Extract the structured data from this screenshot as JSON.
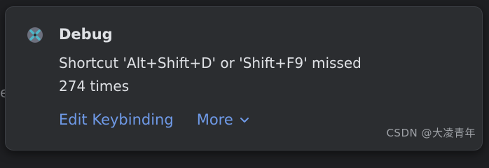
{
  "notification": {
    "title": "Debug",
    "message_line1": "Shortcut 'Alt+Shift+D' or 'Shift+F9' missed",
    "message_line2": "274 times",
    "icon": "debug-icon",
    "actions": {
      "edit_keybinding": "Edit Keybinding",
      "more": "More"
    }
  },
  "background": {
    "fragment": "e"
  },
  "watermark": "CSDN @大凌青年",
  "colors": {
    "popup_bg": "#2b2d30",
    "text": "#dfe1e5",
    "link": "#6f9ae8",
    "icon_teal": "#4fb7c8"
  }
}
